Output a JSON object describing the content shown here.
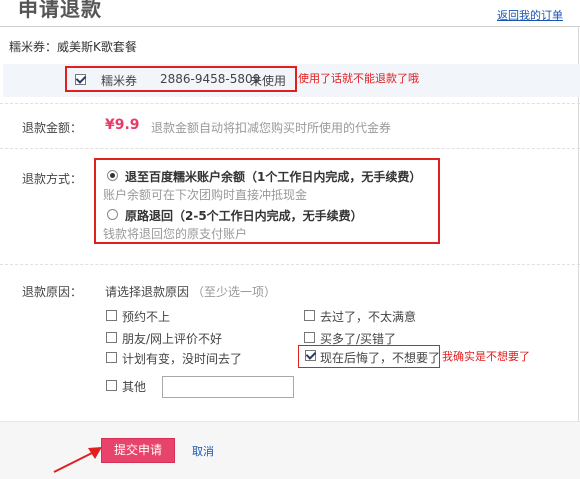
{
  "header": {
    "title": "申请退款",
    "back_link": "返回我的订单"
  },
  "product": {
    "label": "糯米券：威美斯K歌套餐"
  },
  "coupon": {
    "type": "糯米券",
    "code": "2886-9458-5809",
    "status": "未使用",
    "note": "使用了话就不能退款了哦"
  },
  "amount": {
    "label": "退款金额：",
    "value": "¥9.9",
    "hint": "退款金额自动将扣减您购买时所使用的代金券"
  },
  "method": {
    "label": "退款方式：",
    "options": [
      {
        "title": "退至百度糯米账户余额（1个工作日内完成，无手续费）",
        "desc": "账户余额可在下次团购时直接冲抵现金",
        "selected": true
      },
      {
        "title": "原路退回（2-5个工作日内完成，无手续费）",
        "desc": "钱款将退回您的原支付账户",
        "selected": false
      }
    ]
  },
  "reason": {
    "label": "退款原因：",
    "prompt": "请选择退款原因",
    "prompt_hint": "（至少选一项）",
    "items": [
      {
        "text": "预约不上",
        "checked": false
      },
      {
        "text": "去过了，不太满意",
        "checked": false
      },
      {
        "text": "朋友/网上评价不好",
        "checked": false
      },
      {
        "text": "买多了/买错了",
        "checked": false
      },
      {
        "text": "计划有变，没时间去了",
        "checked": false
      },
      {
        "text": "现在后悔了，不想要了",
        "checked": true
      },
      {
        "text": "其他",
        "checked": false
      }
    ],
    "regret_note": "我确实是不想要了",
    "other_value": ""
  },
  "actions": {
    "submit": "提交申请",
    "cancel": "取消"
  },
  "colors": {
    "accent": "#e8436a",
    "link": "#1a55b5",
    "annotation": "#e02020"
  }
}
